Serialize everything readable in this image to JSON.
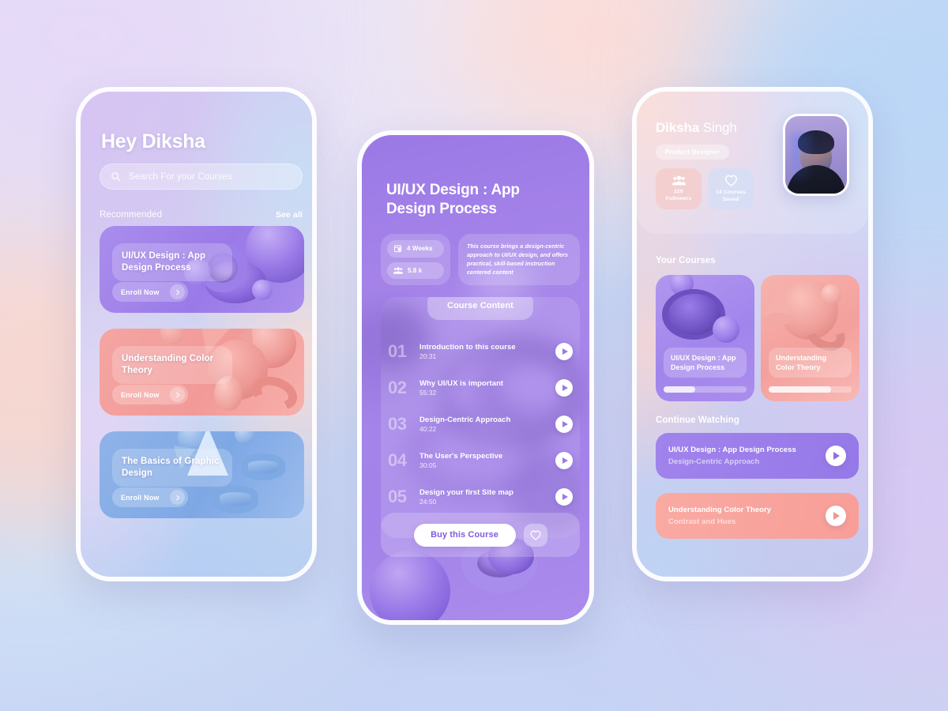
{
  "app": {
    "background_colors": [
      "#e4dcf4",
      "#cfdcf6",
      "#c3cff2",
      "#fbe0de",
      "#bfd6f5"
    ]
  },
  "home": {
    "greeting": "Hey Diksha",
    "search": {
      "placeholder": "Search For your Courses",
      "value": "",
      "icon": "search-icon"
    },
    "section": {
      "title": "Recommended",
      "see_all": "See all"
    },
    "cards": [
      {
        "title": "UI/UX Design : App Design Process",
        "cta": "Enroll Now",
        "color": "#9a7ae8",
        "arrow_icon": "chevron-right-icon"
      },
      {
        "title": "Understanding Color Theory",
        "cta": "Enroll Now",
        "color": "#f29a98",
        "arrow_icon": "chevron-right-icon"
      },
      {
        "title": "The Basics of Graphic Design",
        "cta": "Enroll Now",
        "color": "#7ea8e5",
        "arrow_icon": "chevron-right-icon"
      }
    ]
  },
  "detail": {
    "title": "UI/UX Design : App Design Process",
    "accent": "#9a7ae8",
    "meta": [
      {
        "icon": "calendar-clock-icon",
        "text": "4 Weeks"
      },
      {
        "icon": "people-group-icon",
        "text": "5.8 k"
      }
    ],
    "description": "This course brings a design-centric approach to UI/UX design, and offers practical, skill-based instruction centered content",
    "content_header": "Course Content",
    "lessons": [
      {
        "num": "01",
        "name": "Introduction to this course",
        "duration": "20:31",
        "play_icon": "play-icon"
      },
      {
        "num": "02",
        "name": "Why UI/UX is important",
        "duration": "55:32",
        "play_icon": "play-icon"
      },
      {
        "num": "03",
        "name": "Design-Centric Approach",
        "duration": "40:22",
        "play_icon": "play-icon"
      },
      {
        "num": "04",
        "name": "The User's Perspective",
        "duration": "30:05",
        "play_icon": "play-icon"
      },
      {
        "num": "05",
        "name": "Design your first Site map",
        "duration": "24:50",
        "play_icon": "play-icon"
      }
    ],
    "buy_label": "Buy this Course",
    "favorite_icon": "heart-icon"
  },
  "profile": {
    "first_name": "Diksha",
    "last_name": "Singh",
    "role": "Product Designer",
    "avatar": "user-photo",
    "stats": [
      {
        "icon": "people-group-icon",
        "value": "220",
        "label": "Followers",
        "color": "#f8c2be"
      },
      {
        "icon": "heart-icon",
        "value": "14 Courses",
        "label": "Saved",
        "color": "#cedef8"
      }
    ],
    "your_courses_title": "Your Courses",
    "your_courses": [
      {
        "title": "UI/UX Design : App Design Process",
        "progress": 38,
        "color": "#a285ec"
      },
      {
        "title": "Understanding Color Theory",
        "progress": 75,
        "color": "#f4a09c"
      }
    ],
    "continue_title": "Continue Watching",
    "continue_watching": [
      {
        "title": "UI/UX Design : App Design Process",
        "subtitle": "Design-Centric Approach",
        "color": "#9579e8",
        "play_icon": "play-icon"
      },
      {
        "title": "Understanding Color Theory",
        "subtitle": "Contrast and Hues",
        "color": "#f89e98",
        "play_icon": "play-icon"
      }
    ]
  }
}
